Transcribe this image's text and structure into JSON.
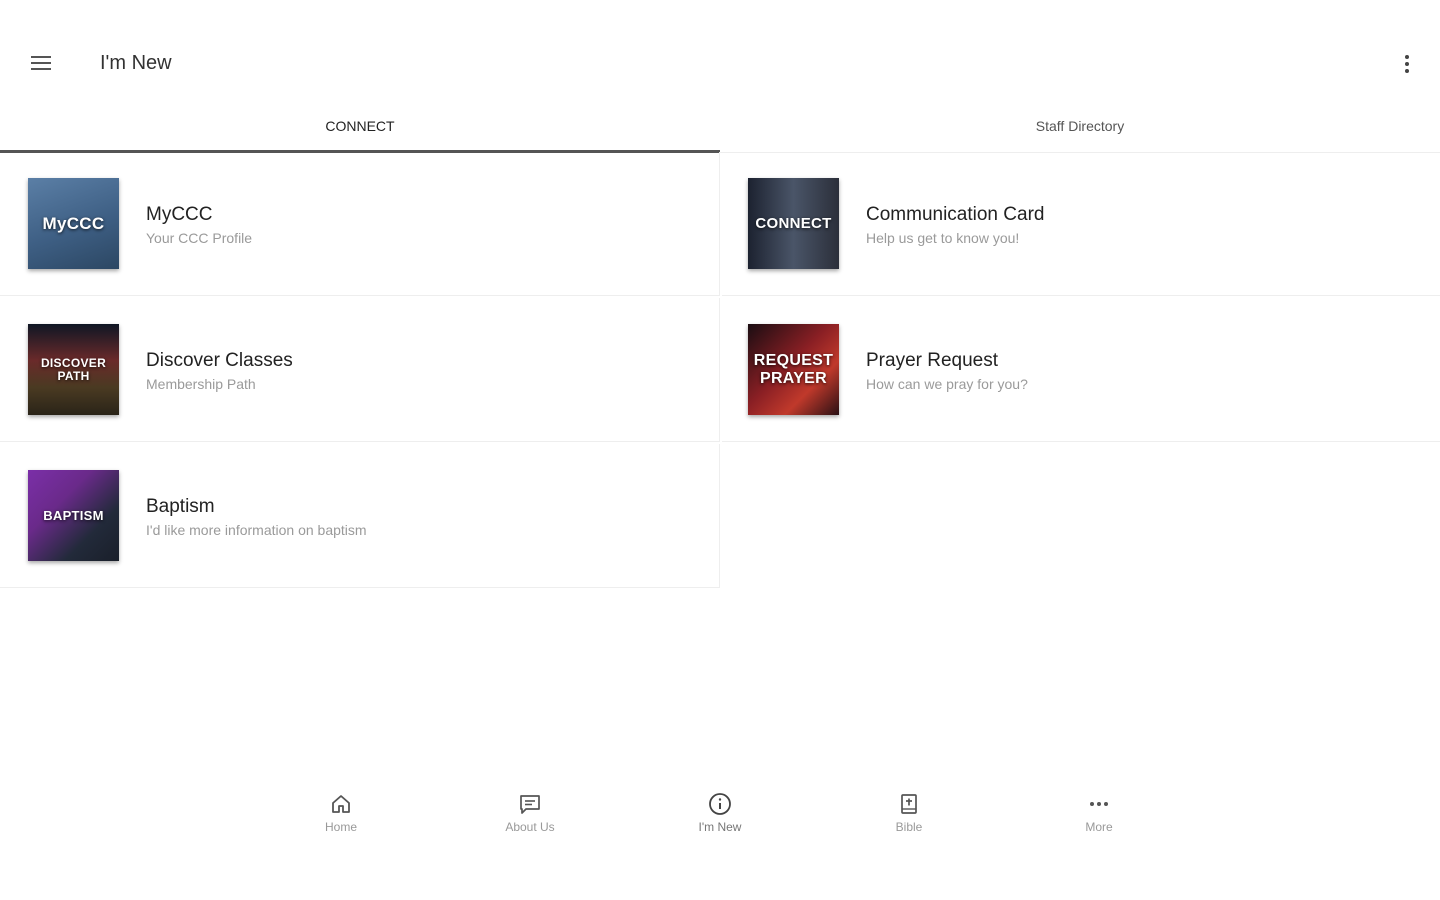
{
  "appbar": {
    "title": "I'm New"
  },
  "tabs": [
    {
      "label": "CONNECT",
      "active": true
    },
    {
      "label": "Staff Directory",
      "active": false
    }
  ],
  "cards": [
    {
      "title": "MyCCC",
      "subtitle": "Your CCC Profile",
      "thumb_text": "MyCCC",
      "thumb_color": "#3e5f84"
    },
    {
      "title": "Communication Card",
      "subtitle": "Help us get to know you!",
      "thumb_text": "CONNECT",
      "thumb_color": "#2b2f3a"
    },
    {
      "title": "Discover Classes",
      "subtitle": "Membership Path",
      "thumb_text": "DISCOVER PATH",
      "thumb_color": "#3a2f22"
    },
    {
      "title": "Prayer Request",
      "subtitle": "How can we pray for you?",
      "thumb_text": "REQUEST PRAYER",
      "thumb_color": "#8a1f24"
    },
    {
      "title": "Baptism",
      "subtitle": "I'd like more information on baptism",
      "thumb_text": "BAPTISM",
      "thumb_color": "#6a2a8a"
    }
  ],
  "bottom_nav": [
    {
      "label": "Home",
      "icon": "home-icon"
    },
    {
      "label": "About Us",
      "icon": "message-icon"
    },
    {
      "label": "I'm New",
      "icon": "info-icon"
    },
    {
      "label": "Bible",
      "icon": "bible-icon"
    },
    {
      "label": "More",
      "icon": "more-icon"
    }
  ]
}
